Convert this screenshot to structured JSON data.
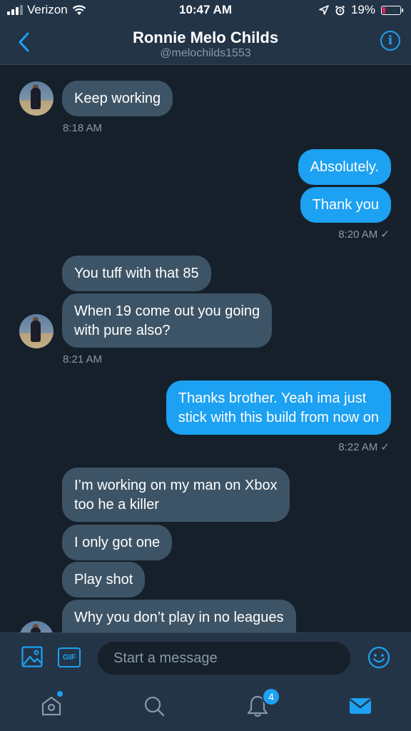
{
  "status_bar": {
    "carrier": "Verizon",
    "time": "10:47 AM",
    "battery_percent": "19%",
    "battery_level": 0.19
  },
  "header": {
    "name": "Ronnie Melo Childs",
    "handle": "@melochilds1553",
    "info_glyph": "i"
  },
  "messages": [
    {
      "dir": "in",
      "text": "Keep working"
    },
    {
      "dir": "in",
      "timestamp": "8:18 AM"
    },
    {
      "dir": "out",
      "text": "Absolutely."
    },
    {
      "dir": "out",
      "text": "Thank you"
    },
    {
      "dir": "out",
      "timestamp": "8:20 AM ✓"
    },
    {
      "dir": "in",
      "text": "You tuff with that 85"
    },
    {
      "dir": "in",
      "lines": [
        "When 19 come out you going",
        "with pure also?"
      ]
    },
    {
      "dir": "in",
      "timestamp": "8:21 AM"
    },
    {
      "dir": "out",
      "lines": [
        "Thanks brother. Yeah ima just",
        "stick with this build from now on"
      ]
    },
    {
      "dir": "out",
      "timestamp": "8:22 AM ✓"
    },
    {
      "dir": "in",
      "lines": [
        "I’m working on my man on Xbox",
        "too he a killer"
      ]
    },
    {
      "dir": "in",
      "text": "I only got one"
    },
    {
      "dir": "in",
      "text": "Play shot"
    },
    {
      "dir": "in",
      "text": "Why you don’t play in no leagues"
    }
  ],
  "composer": {
    "placeholder": "Start a message",
    "gif_label": "GIF"
  },
  "tab_bar": {
    "notifications_badge": "4",
    "items": [
      "home-icon",
      "search-icon",
      "notifications-icon",
      "messages-icon"
    ]
  },
  "colors": {
    "accent": "#1da1f2",
    "background": "#15202b",
    "bar": "#243447",
    "incoming_bubble": "#3d5466",
    "muted_text": "#8899a6"
  }
}
